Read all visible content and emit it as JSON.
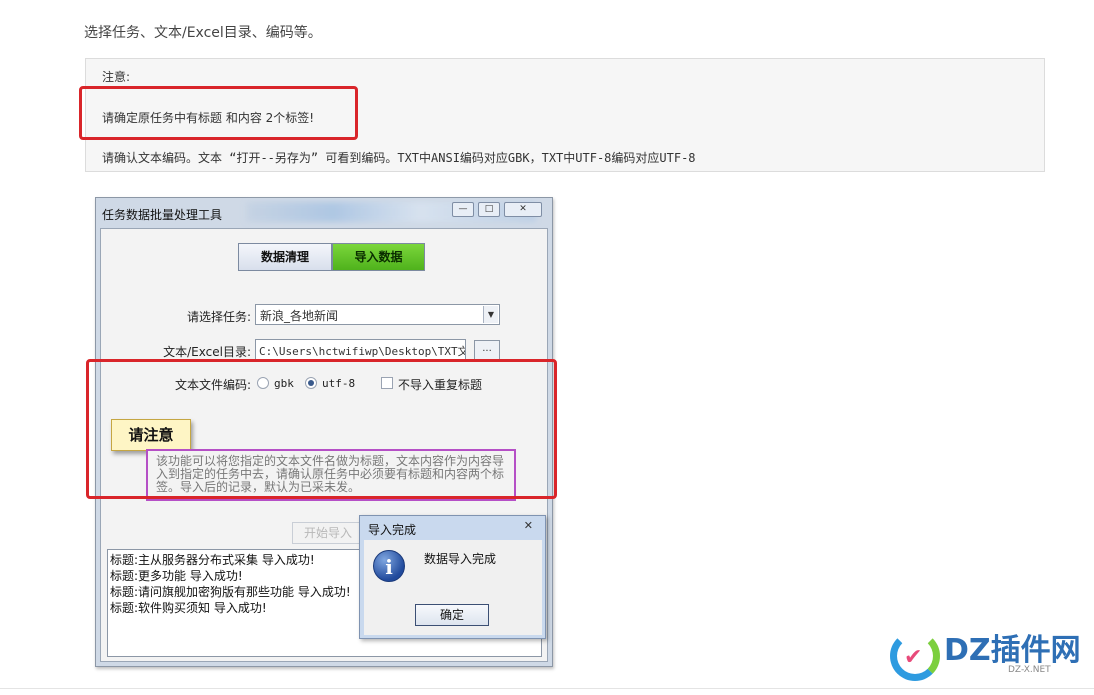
{
  "intro_text": "选择任务、文本/Excel目录、编码等。",
  "note": {
    "title": "注意:",
    "line1": "请确定原任务中有标题 和内容 2个标签!",
    "line2": "请确认文本编码。文本 “打开--另存为” 可看到编码。TXT中ANSI编码对应GBK，TXT中UTF-8编码对应UTF-8"
  },
  "window": {
    "title": "任务数据批量处理工具",
    "controls": [
      "—",
      "□",
      "✕"
    ],
    "tabs": [
      {
        "label": "数据清理",
        "selected": false
      },
      {
        "label": "导入数据",
        "selected": true
      }
    ],
    "task_label": "请选择任务:",
    "task_value": "新浪_各地新闻",
    "dir_label": "文本/Excel目录:",
    "dir_value": "C:\\Users\\hctwifiwp\\Desktop\\TXT文章",
    "browse_label": "...",
    "encoding_label": "文本文件编码:",
    "encoding_options": [
      "gbk",
      "utf-8"
    ],
    "encoding_selected": "utf-8",
    "no_dup_label": "不导入重复标题",
    "no_dup_checked": false,
    "notice_label": "请注意",
    "description": "该功能可以将您指定的文本文件名做为标题，文本内容作为内容导入到指定的任务中去，请确认原任务中必须要有标题和内容两个标签。导入后的记录，默认为已采未发。",
    "start_button": "开始导入",
    "log_lines": [
      "标题:主从服务器分布式采集 导入成功!",
      "标题:更多功能 导入成功!",
      "标题:请问旗舰加密狗版有那些功能 导入成功!",
      "标题:软件购买须知 导入成功!"
    ]
  },
  "dialog": {
    "title": "导入完成",
    "close": "✕",
    "message": "数据导入完成",
    "ok_button": "确定",
    "icon": "info-icon"
  },
  "watermark": {
    "brand": "DZ插件网",
    "sub": "DZ-X.NET"
  }
}
